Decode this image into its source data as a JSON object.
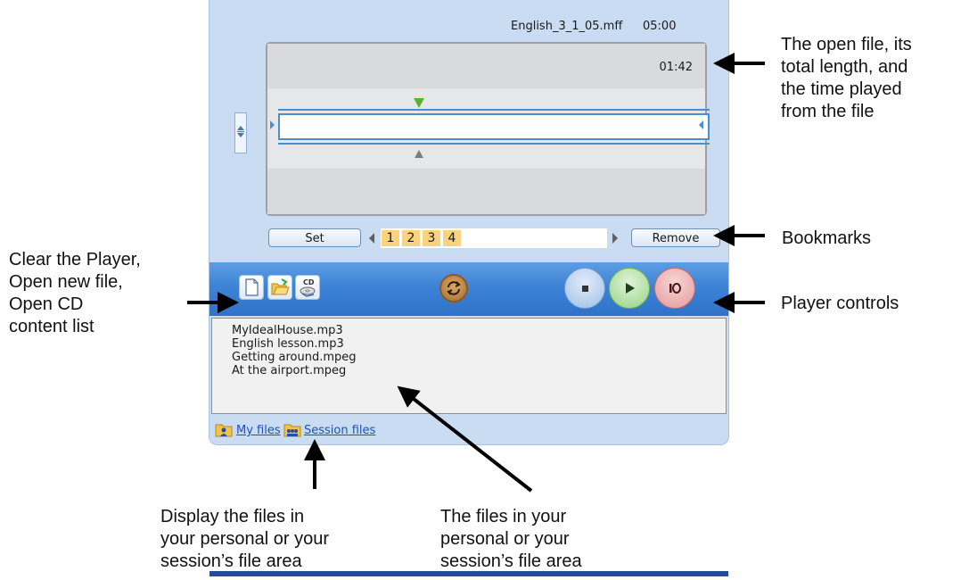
{
  "player": {
    "file_name": "English_3_1_05.mff",
    "file_length": "05:00",
    "time_played": "01:42",
    "bookmarks": {
      "set_label": "Set",
      "remove_label": "Remove",
      "items": [
        "1",
        "2",
        "3",
        "4"
      ]
    },
    "controls": {
      "clear_icon": "blank-page-icon",
      "open_icon": "open-folder-icon",
      "cd_icon": "cd-list-icon",
      "repeat_icon": "repeat-icon",
      "stop_icon": "stop-icon",
      "play_icon": "play-icon",
      "record_icon": "record-icon",
      "cd_text": "CD"
    },
    "files": [
      "MyIdealHouse.mp3",
      "English lesson.mp3",
      "Getting around.mpeg",
      "At the airport.mpeg"
    ],
    "footer": {
      "my_files": "My files",
      "session_files": "Session files"
    }
  },
  "annotations": {
    "file_info": "The open file, its\ntotal length, and\nthe time played\nfrom the file",
    "bookmarks": "Bookmarks",
    "player_controls": "Player controls",
    "clear_open": "Clear the Player,\nOpen new file,\nOpen CD\ncontent list",
    "display_files": "Display the files in\nyour personal or your\nsession’s file area",
    "files_area": "The files in your\npersonal or your\nsession’s file area"
  },
  "colors": {
    "panel_bg": "#c9dcf1",
    "accent_blue": "#3d83d6",
    "bookmark": "#fbd27e",
    "marker_green": "#5ab52e"
  }
}
